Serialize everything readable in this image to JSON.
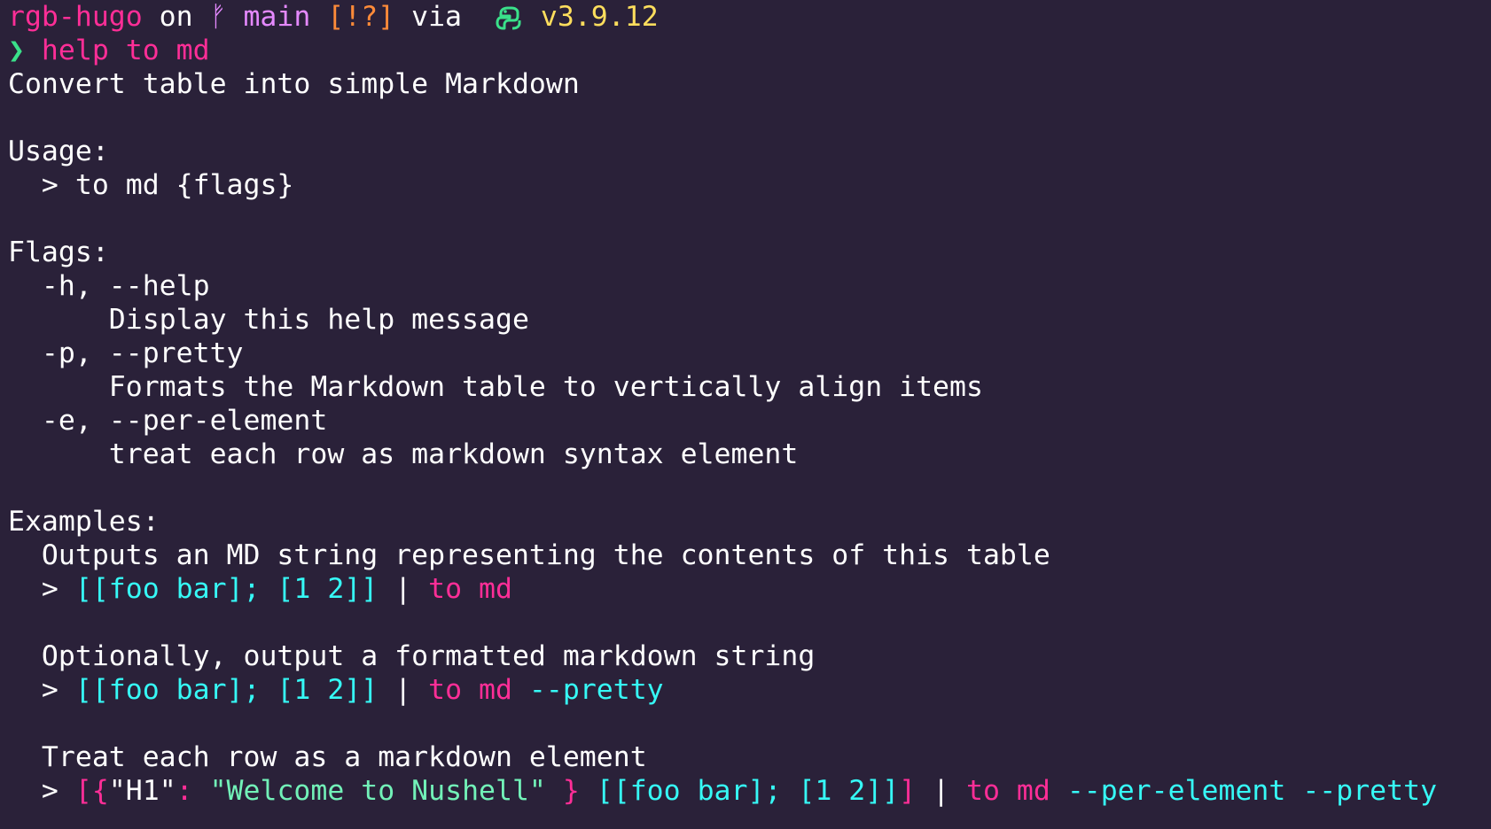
{
  "prompt": {
    "dir": "rgb-hugo",
    "on": " on ",
    "branch_glyph": "ᚠ",
    "branch": " main ",
    "status": "[!?]",
    "via": " via ",
    "python_icon": "python-icon",
    "version": " v3.9.12"
  },
  "command": {
    "symbol": "❯",
    "word1": " help",
    "word2": " to md"
  },
  "description": "Convert table into simple Markdown",
  "usage": {
    "heading": "Usage:",
    "line": "  > to md {flags}"
  },
  "flags": {
    "heading": "Flags:",
    "items": [
      {
        "flag": "  -h, --help",
        "desc": "      Display this help message"
      },
      {
        "flag": "  -p, --pretty",
        "desc": "      Formats the Markdown table to vertically align items"
      },
      {
        "flag": "  -e, --per-element",
        "desc": "      treat each row as markdown syntax element"
      }
    ]
  },
  "examples": {
    "heading": "Examples:",
    "items": [
      {
        "desc": "  Outputs an MD string representing the contents of this table",
        "prompt": "  > ",
        "data": "[[foo bar]; [1 2]]",
        "pipe": " | ",
        "cmd": "to md",
        "flag": ""
      },
      {
        "desc": "  Optionally, output a formatted markdown string",
        "prompt": "  > ",
        "data": "[[foo bar]; [1 2]]",
        "pipe": " | ",
        "cmd": "to md",
        "flag": " --pretty"
      },
      {
        "desc": "  Treat each row as a markdown element",
        "prompt": "  > ",
        "record_open": "[{",
        "record_key": "\"H1\"",
        "record_colon": ": ",
        "record_value": "\"Welcome to Nushell\"",
        "record_close": " }",
        "data": " [[foo bar]; [1 2]]",
        "data_close": "]",
        "pipe": " | ",
        "cmd": "to md",
        "flag": " --per-element --pretty"
      }
    ]
  },
  "colors": {
    "background": "#2a2139",
    "pink": "#ff2e97",
    "purple": "#e589ff",
    "orange": "#ff8b39",
    "green": "#3ae18a",
    "yellow": "#fede5d",
    "cyan": "#36f9f6",
    "teal": "#72f1b8",
    "text": "#ffffff"
  }
}
